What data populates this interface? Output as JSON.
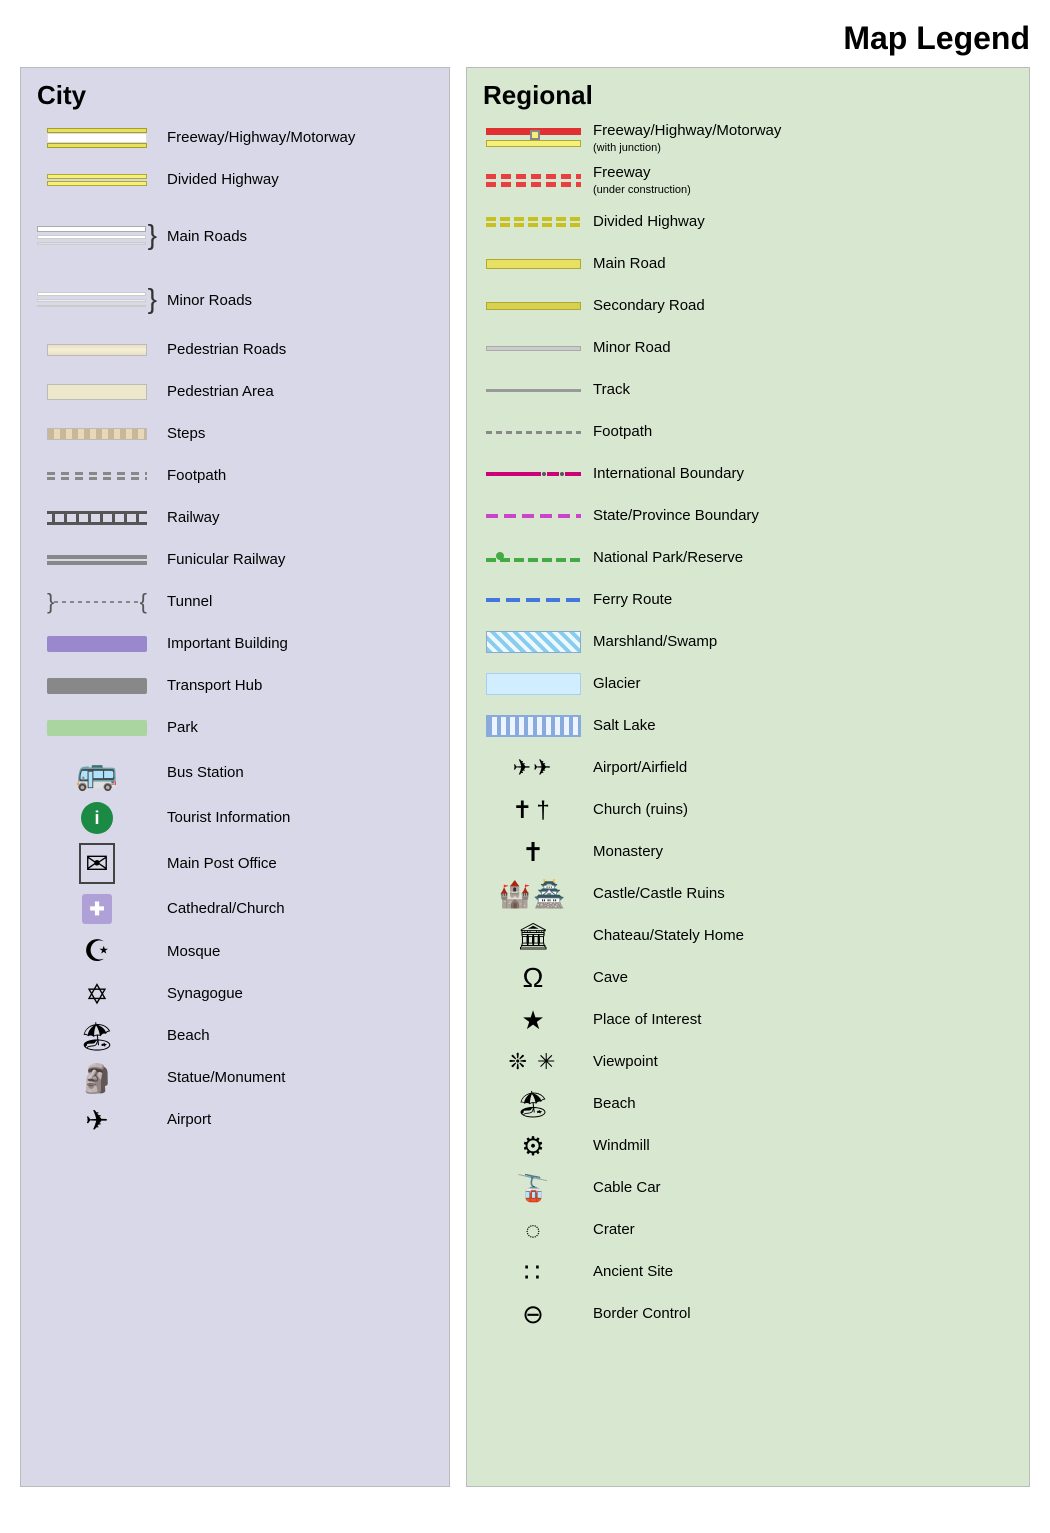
{
  "title": "Map Legend",
  "city": {
    "heading": "City",
    "items": [
      {
        "label": "Freeway/Highway/Motorway",
        "symbol_type": "city-freeway"
      },
      {
        "label": "Divided Highway",
        "symbol_type": "city-divided-highway"
      },
      {
        "label": "Main Roads",
        "symbol_type": "city-main-roads"
      },
      {
        "label": "Minor Roads",
        "symbol_type": "city-minor-roads"
      },
      {
        "label": "Pedestrian Roads",
        "symbol_type": "city-ped-roads"
      },
      {
        "label": "Pedestrian Area",
        "symbol_type": "city-ped-area"
      },
      {
        "label": "Steps",
        "symbol_type": "city-steps"
      },
      {
        "label": "Footpath",
        "symbol_type": "city-footpath"
      },
      {
        "label": "Railway",
        "symbol_type": "city-railway"
      },
      {
        "label": "Funicular Railway",
        "symbol_type": "city-funicular"
      },
      {
        "label": "Tunnel",
        "symbol_type": "city-tunnel"
      },
      {
        "label": "Important Building",
        "symbol_type": "city-important-building"
      },
      {
        "label": "Transport Hub",
        "symbol_type": "city-transport-hub"
      },
      {
        "label": "Park",
        "symbol_type": "city-park"
      },
      {
        "label": "Bus Station",
        "symbol_type": "city-bus-station",
        "icon": "🚌"
      },
      {
        "label": "Tourist Information",
        "symbol_type": "city-tourist-info"
      },
      {
        "label": "Main Post Office",
        "symbol_type": "city-post-office",
        "icon": "✉"
      },
      {
        "label": "Cathedral/Church",
        "symbol_type": "city-cathedral"
      },
      {
        "label": "Mosque",
        "symbol_type": "city-mosque",
        "icon": "☪"
      },
      {
        "label": "Synagogue",
        "symbol_type": "city-synagogue",
        "icon": "✡"
      },
      {
        "label": "Beach",
        "symbol_type": "city-beach",
        "icon": "🏖"
      },
      {
        "label": "Statue/Monument",
        "symbol_type": "city-statue",
        "icon": "🗿"
      },
      {
        "label": "Airport",
        "symbol_type": "city-airport",
        "icon": "✈"
      }
    ]
  },
  "regional": {
    "heading": "Regional",
    "items": [
      {
        "label": "Freeway/Highway/Motorway",
        "label2": "(with junction)",
        "symbol_type": "reg-freeway"
      },
      {
        "label": "Freeway",
        "label2": "(under construction)",
        "symbol_type": "reg-freeway-uc"
      },
      {
        "label": "Divided Highway",
        "symbol_type": "reg-divided-highway"
      },
      {
        "label": "Main Road",
        "symbol_type": "reg-main-road"
      },
      {
        "label": "Secondary Road",
        "symbol_type": "reg-secondary-road"
      },
      {
        "label": "Minor Road",
        "symbol_type": "reg-minor-road"
      },
      {
        "label": "Track",
        "symbol_type": "reg-track"
      },
      {
        "label": "Footpath",
        "symbol_type": "reg-footpath"
      },
      {
        "label": "International Boundary",
        "symbol_type": "reg-intl-boundary"
      },
      {
        "label": "State/Province Boundary",
        "symbol_type": "reg-state-boundary"
      },
      {
        "label": "National Park/Reserve",
        "symbol_type": "reg-national-park"
      },
      {
        "label": "Ferry Route",
        "symbol_type": "reg-ferry"
      },
      {
        "label": "Marshland/Swamp",
        "symbol_type": "reg-marsh"
      },
      {
        "label": "Glacier",
        "symbol_type": "reg-glacier"
      },
      {
        "label": "Salt Lake",
        "symbol_type": "reg-salt-lake"
      },
      {
        "label": "Airport/Airfield",
        "symbol_type": "reg-airport",
        "icon": "✈✈"
      },
      {
        "label": "Church (ruins)",
        "symbol_type": "reg-church",
        "icon": "✝†"
      },
      {
        "label": "Monastery",
        "symbol_type": "reg-monastery",
        "icon": "✝"
      },
      {
        "label": "Castle/Castle Ruins",
        "symbol_type": "reg-castle",
        "icon": "🏰"
      },
      {
        "label": "Chateau/Stately Home",
        "symbol_type": "reg-chateau",
        "icon": "🏛"
      },
      {
        "label": "Cave",
        "symbol_type": "reg-cave",
        "icon": "Ω"
      },
      {
        "label": "Place of Interest",
        "symbol_type": "reg-poi",
        "icon": "★"
      },
      {
        "label": "Viewpoint",
        "symbol_type": "reg-viewpoint",
        "icon": "❇ ✳"
      },
      {
        "label": "Beach",
        "symbol_type": "reg-beach",
        "icon": "🏖"
      },
      {
        "label": "Windmill",
        "symbol_type": "reg-windmill",
        "icon": "⚙"
      },
      {
        "label": "Cable Car",
        "symbol_type": "reg-cable-car",
        "icon": "🚡"
      },
      {
        "label": "Crater",
        "symbol_type": "reg-crater",
        "icon": "◌"
      },
      {
        "label": "Ancient Site",
        "symbol_type": "reg-ancient",
        "icon": "⁚"
      },
      {
        "label": "Border Control",
        "symbol_type": "reg-border",
        "icon": "⊖"
      }
    ]
  }
}
